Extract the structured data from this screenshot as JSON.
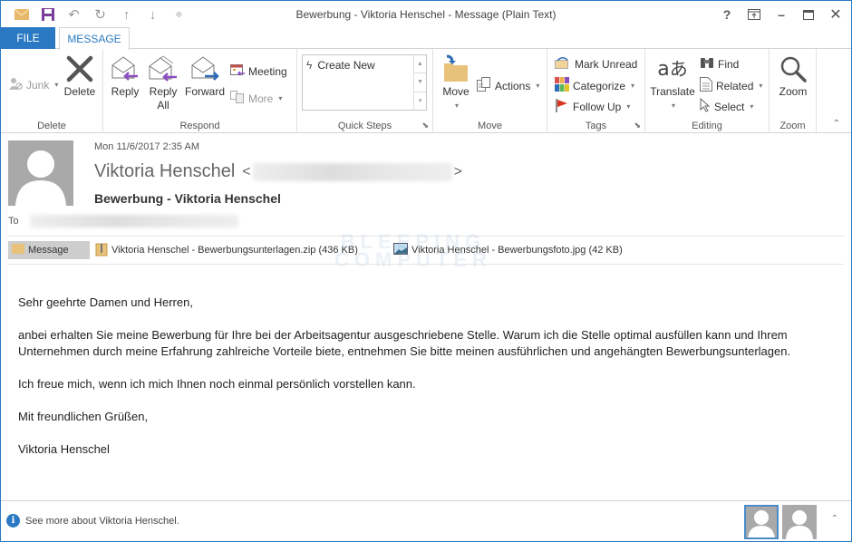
{
  "window": {
    "title": "Bewerbung - Viktoria Henschel - Message (Plain Text)",
    "controls": [
      "help",
      "ribbon-display-options",
      "minimize",
      "maximize",
      "close"
    ]
  },
  "quick_access": [
    "mail-icon",
    "save-icon",
    "undo-icon",
    "redo-icon",
    "up-icon",
    "down-icon",
    "customize-icon"
  ],
  "tabs": {
    "file": "FILE",
    "message": "MESSAGE"
  },
  "ribbon": {
    "groups": {
      "delete": {
        "label": "Delete",
        "junk": "Junk",
        "delete": "Delete"
      },
      "respond": {
        "label": "Respond",
        "reply": "Reply",
        "reply_all_line1": "Reply",
        "reply_all_line2": "All",
        "forward": "Forward",
        "meeting": "Meeting",
        "more": "More"
      },
      "quick_steps": {
        "label": "Quick Steps",
        "create_new": "Create New"
      },
      "move": {
        "label": "Move",
        "move": "Move",
        "actions": "Actions"
      },
      "tags": {
        "label": "Tags",
        "mark_unread": "Mark Unread",
        "categorize": "Categorize",
        "follow_up": "Follow Up"
      },
      "editing": {
        "label": "Editing",
        "translate": "Translate",
        "find": "Find",
        "related": "Related",
        "select": "Select"
      },
      "zoom": {
        "label": "Zoom",
        "zoom": "Zoom"
      }
    }
  },
  "message": {
    "date": "Mon 11/6/2017 2:35 AM",
    "sender_name": "Viktoria Henschel",
    "sender_open": "<",
    "sender_close": ">",
    "subject": "Bewerbung - Viktoria Henschel",
    "to_label": "To",
    "attachments": [
      {
        "label": "Message",
        "type": "message"
      },
      {
        "label": "Viktoria Henschel - Bewerbungsunterlagen.zip (436 KB)",
        "type": "zip"
      },
      {
        "label": "Viktoria Henschel - Bewerbungsfoto.jpg (42 KB)",
        "type": "image"
      }
    ],
    "body": [
      "Sehr geehrte Damen und Herren,",
      "anbei erhalten Sie meine Bewerbung für Ihre bei der Arbeitsagentur ausgeschriebene Stelle. Warum ich die Stelle optimal ausfüllen kann und Ihrem Unternehmen durch meine Erfahrung zahlreiche Vorteile biete, entnehmen Sie bitte meinen ausführlichen und angehängten Bewerbungsunterlagen.",
      "Ich freue mich, wenn ich mich Ihnen noch einmal persönlich vorstellen kann.",
      "Mit freundlichen Grüßen,",
      "Viktoria Henschel"
    ]
  },
  "watermark": {
    "line1": "BLEEPING",
    "line2": "COMPUTER"
  },
  "footer": {
    "see_more": "See more about Viktoria Henschel."
  },
  "colors": {
    "accent": "#2b79c2",
    "avatar_gray": "#a9a9a9"
  }
}
